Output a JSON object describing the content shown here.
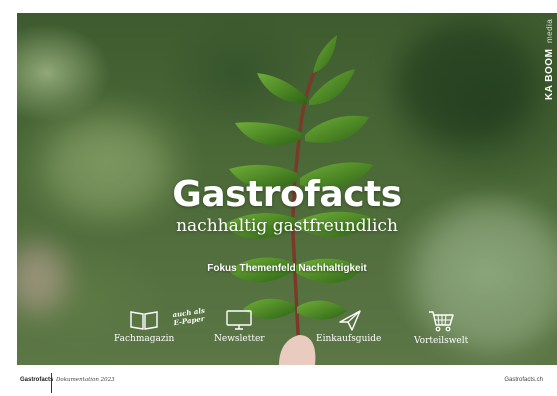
{
  "hero": {
    "logo_main": "KA BOOM",
    "logo_sub": "media",
    "title": "Gastrofacts",
    "subtitle": "nachhaltig gastfreundlich",
    "focus": "Fokus Themenfeld Nachhaltigkeit",
    "epaper_note_line1": "auch als",
    "epaper_note_line2": "E-Paper"
  },
  "nav": [
    {
      "label": "Fachmagazin",
      "icon": "open-book-icon"
    },
    {
      "label": "Newsletter",
      "icon": "monitor-icon"
    },
    {
      "label": "Einkaufsguide",
      "icon": "paper-plane-icon"
    },
    {
      "label": "Vorteilswelt",
      "icon": "shopping-cart-icon"
    }
  ],
  "footer": {
    "brand": "Gastrofacts",
    "doc": "Dokumentation 2023",
    "site": "Gastrofacts.ch"
  },
  "colors": {
    "text": "#ffffff",
    "leaf": "#3f7a1f",
    "stem": "#7a3a2a"
  }
}
